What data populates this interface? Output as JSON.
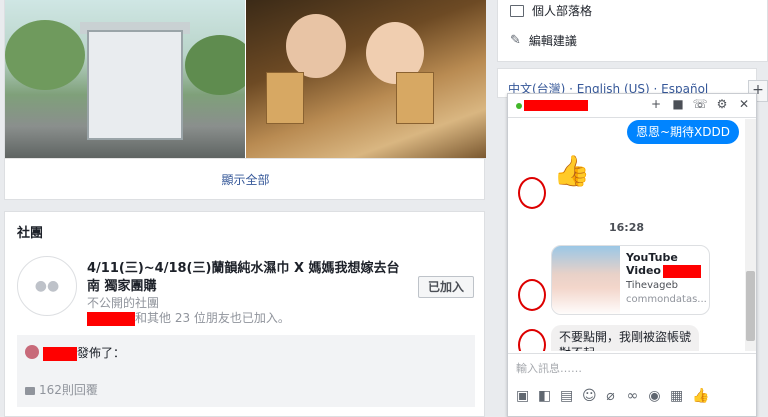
{
  "feed": {
    "show_all": "顯示全部",
    "groups_title": "社團",
    "group": {
      "name": "4/11(三)~4/18(三)蘭韻純水濕巾 X 媽媽我想嫁去台南 獨家團購",
      "privacy": "不公開的社團",
      "friends_suffix": "和其他 23 位朋友也已加入。",
      "joined_label": "已加入"
    },
    "post": {
      "action": "發佈了：",
      "replies": "162則回覆"
    }
  },
  "right": {
    "links": [
      "個人部落格",
      "編輯建議"
    ],
    "language": "中文(台灣) · English (US) · Español"
  },
  "chat": {
    "messages_out": [
      "恩恩~期待XDDD"
    ],
    "time": "16:28",
    "link_preview": {
      "title_line1": "YouTube",
      "title_line2": "Video",
      "channel": "Tihevageb",
      "domain": "commondatas..."
    },
    "message_in": "不要點開，我剛被盜帳號對不起",
    "input_placeholder": "輸入訊息……"
  },
  "icons": {
    "header": [
      "plus-icon",
      "video-icon",
      "phone-icon",
      "gear-icon",
      "close-icon"
    ],
    "tools": [
      "photo-icon",
      "sticker-icon",
      "gif-icon",
      "emoji-icon",
      "attach-icon",
      "link-icon",
      "camera-icon",
      "table-icon",
      "like-icon"
    ]
  },
  "colors": {
    "link_blue": "#365899",
    "messenger_blue": "#0084ff",
    "redaction": "#ff0000"
  }
}
